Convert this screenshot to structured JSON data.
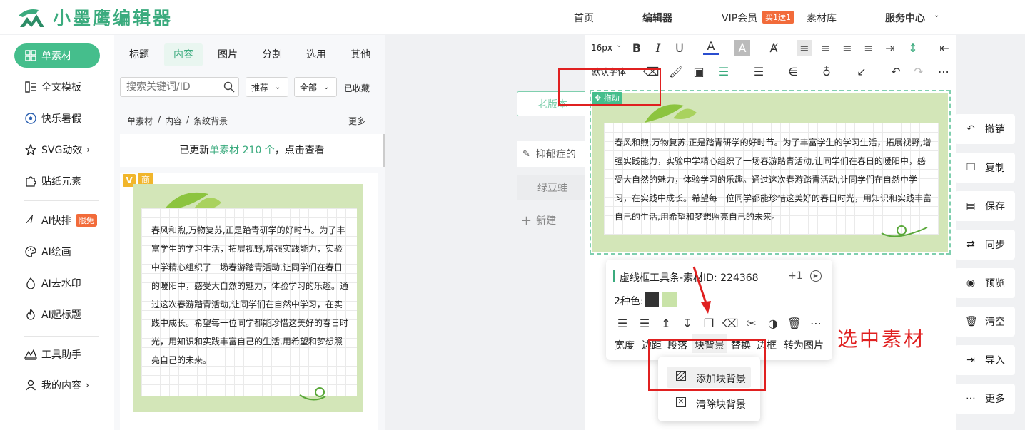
{
  "header": {
    "logo_text": "小墨鹰编辑器",
    "nav": [
      "首页",
      "编辑器",
      "VIP会员",
      "素材库",
      "服务中心"
    ],
    "vip_badge": "买1送1"
  },
  "sidebar": {
    "items": [
      {
        "label": "单素材",
        "icon": "grid-icon"
      },
      {
        "label": "全文模板",
        "icon": "template-icon"
      },
      {
        "label": "快乐暑假",
        "icon": "soccer-ball-icon"
      },
      {
        "label": "SVG动效",
        "icon": "star-outline-icon"
      },
      {
        "label": "贴纸元素",
        "icon": "puzzle-icon"
      },
      {
        "label": "AI快排",
        "icon": "ai-icon",
        "badge": "限免"
      },
      {
        "label": "AI绘画",
        "icon": "palette-icon"
      },
      {
        "label": "AI去水印",
        "icon": "drop-icon"
      },
      {
        "label": "AI起标题",
        "icon": "flame-icon"
      },
      {
        "label": "工具助手",
        "icon": "tools-icon"
      },
      {
        "label": "我的内容",
        "icon": "user-icon"
      }
    ]
  },
  "panel": {
    "tabs": [
      "标题",
      "内容",
      "图片",
      "分割",
      "选用",
      "其他"
    ],
    "search_placeholder": "搜索关键词/ID",
    "sort": "推荐",
    "filter": "全部",
    "favorites": "已收藏",
    "breadcrumb": [
      "单素材",
      "内容",
      "条纹背景"
    ],
    "more": "更多",
    "update_prefix": "已更新",
    "update_link": "单素材 210 个",
    "update_suffix": "，点击查看",
    "card_badge": "商",
    "card_text": "春风和煦,万物复苏,正是踏青研学的好时节。为了丰富学生的学习生活，拓展视野,增强实践能力，实验中学精心组织了一场春游踏青活动,让同学们在春日的暖阳中，感受大自然的魅力，体验学习的乐趣。通过这次春游踏青活动,让同学们在自然中学习，在实践中成长。希望每一位同学都能珍惜这美好的春日时光，用知识和实践丰富自己的生活,用希望和梦想照亮自己的未来。"
  },
  "canvas": {
    "old_version": "老版本",
    "doc1": "抑郁症的",
    "doc2": "绿豆蛙",
    "new": "新建"
  },
  "toolbar": {
    "font_size": "16px",
    "font_family": "默认字体"
  },
  "editor": {
    "drag_label": "拖动",
    "content_text": "春风和煦,万物复苏,正是踏青研学的好时节。为了丰富学生的学习生活，拓展视野,增强实践能力，实验中学精心组织了一场春游踏青活动,让同学们在春日的暖阳中，感受大自然的魅力，体验学习的乐趣。通过这次春游踏青活动,让同学们在自然中学习，在实践中成长。希望每一位同学都能珍惜这美好的春日时光，用知识和实践丰富自己的生活,用希望和梦想照亮自己的未来。"
  },
  "popup": {
    "title": "虚线框工具条-素材ID: 224368",
    "plus": "+1",
    "colors_label": "2种色:",
    "swatches": [
      "#333333",
      "#c9e3a8"
    ],
    "actions": [
      "宽度",
      "边距",
      "段落",
      "块背景",
      "替换",
      "边框",
      "转为图片"
    ],
    "submenu": [
      "添加块背景",
      "清除块背景"
    ]
  },
  "right_actions": [
    "撤销",
    "复制",
    "保存",
    "同步",
    "预览",
    "清空",
    "导入",
    "更多"
  ],
  "annotation": "选中素材",
  "colors": {
    "brand": "#3bab7e",
    "accent_red": "#e02020",
    "card_green": "#d3e6b8"
  }
}
